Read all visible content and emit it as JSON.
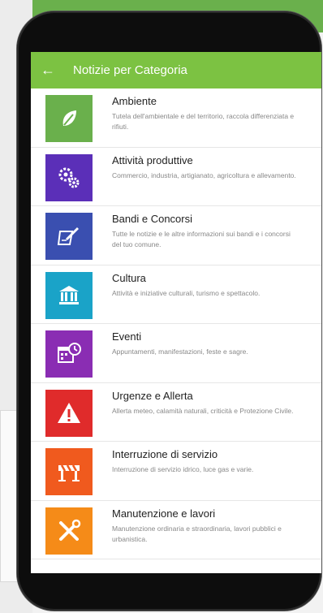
{
  "header": {
    "back_icon": "arrow-left-icon",
    "title": "Notizie per Categoria"
  },
  "categories": [
    {
      "name": "Ambiente",
      "description": "Tutela dell'ambientale e del territorio, raccola differenziata e rifiuti.",
      "color": "#6ab04c",
      "icon": "leaf-icon"
    },
    {
      "name": "Attività produttive",
      "description": "Commercio, industria, artigianato, agricoltura e allevamento.",
      "color": "#5b2fb8",
      "icon": "gears-icon"
    },
    {
      "name": "Bandi e Concorsi",
      "description": "Tutte le notizie e le altre informazioni sui bandi e i concorsi del tuo comune.",
      "color": "#3a4fb0",
      "icon": "document-pen-icon"
    },
    {
      "name": "Cultura",
      "description": "Attività e iniziative culturali, turismo e spettacolo.",
      "color": "#1aa3c8",
      "icon": "museum-icon"
    },
    {
      "name": "Eventi",
      "description": "Appuntamenti, manifestazioni, feste e sagre.",
      "color": "#8a2db3",
      "icon": "calendar-clock-icon"
    },
    {
      "name": "Urgenze e Allerta",
      "description": "Allerta meteo, calamità naturali, criticità e Protezione Civile.",
      "color": "#e02b2b",
      "icon": "warning-icon"
    },
    {
      "name": "Interruzione di servizio",
      "description": "Interruzione di servizio idrico, luce gas e varie.",
      "color": "#f05a1e",
      "icon": "barrier-icon"
    },
    {
      "name": "Manutenzione e lavori",
      "description": "Manutenzione ordinaria e straordinaria, lavori pubblici e urbanistica.",
      "color": "#f58b18",
      "icon": "tools-icon"
    }
  ]
}
